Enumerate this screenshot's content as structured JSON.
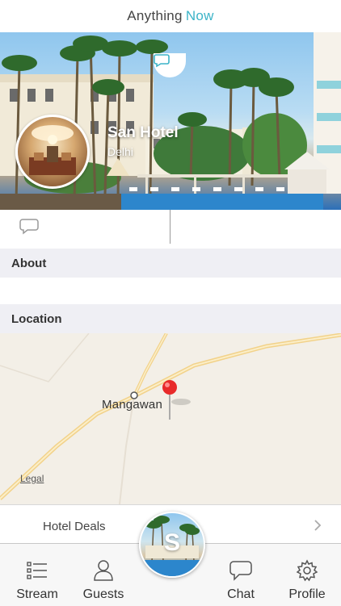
{
  "header": {
    "brand_part1": "Anything",
    "brand_part2": "Now",
    "accent_color": "#3cb4c8"
  },
  "hero": {
    "hotel_name": "San Hotel",
    "city": "Delhi"
  },
  "sections": {
    "about_title": "About",
    "location_title": "Location"
  },
  "map": {
    "place_label": "Mangawan",
    "legal_link": "Legal"
  },
  "deals": {
    "label": "Hotel Deals"
  },
  "tabbar": {
    "center_letter": "S",
    "items": [
      {
        "label": "Stream",
        "icon": "list-icon"
      },
      {
        "label": "Guests",
        "icon": "person-icon"
      },
      {
        "label": "Chat",
        "icon": "chat-bubble-icon"
      },
      {
        "label": "Profile",
        "icon": "gear-icon"
      }
    ]
  }
}
